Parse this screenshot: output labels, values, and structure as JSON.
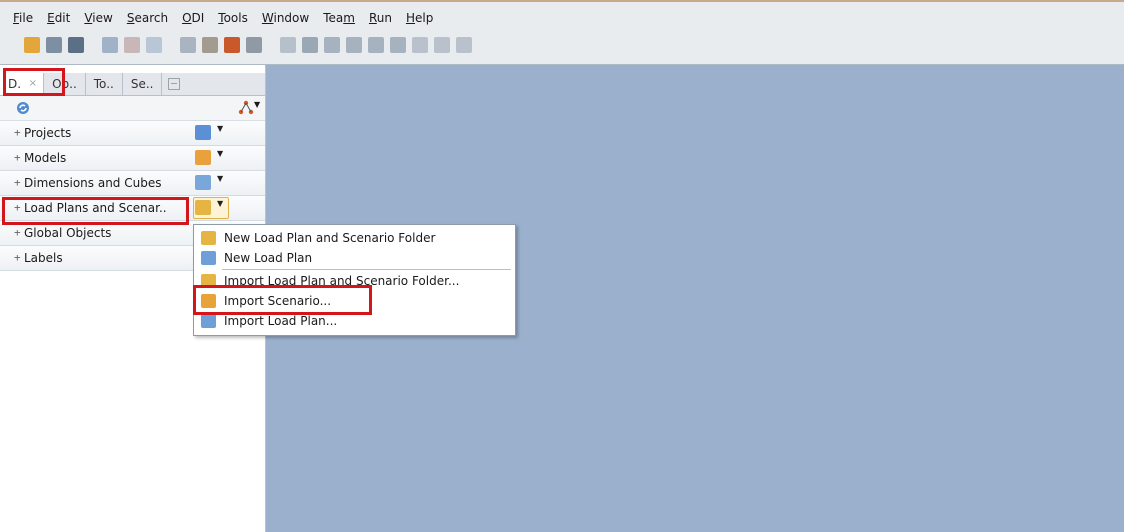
{
  "menubar": {
    "items": [
      {
        "pre": "",
        "mn": "F",
        "post": "ile"
      },
      {
        "pre": "",
        "mn": "E",
        "post": "dit"
      },
      {
        "pre": "",
        "mn": "V",
        "post": "iew"
      },
      {
        "pre": "",
        "mn": "S",
        "post": "earch"
      },
      {
        "pre": "",
        "mn": "O",
        "post": "DI"
      },
      {
        "pre": "",
        "mn": "T",
        "post": "ools"
      },
      {
        "pre": "",
        "mn": "W",
        "post": "indow"
      },
      {
        "pre": "Tea",
        "mn": "m",
        "post": ""
      },
      {
        "pre": "",
        "mn": "R",
        "post": "un"
      },
      {
        "pre": "",
        "mn": "H",
        "post": "elp"
      }
    ]
  },
  "toolbar": {
    "icons": [
      "new-icon",
      "save-icon",
      "save-all-icon",
      "gap",
      "run-icon",
      "debug-icon",
      "play-icon",
      "gap",
      "breakpoint-icon",
      "bug-icon",
      "step-icon",
      "step-over-icon",
      "gap",
      "agent-icon",
      "session-icon",
      "db-icon-1",
      "db-icon-2",
      "db-icon-3",
      "db-icon-4",
      "pause-icon",
      "resume-icon",
      "forward-icon"
    ]
  },
  "tabs": [
    {
      "label": "D.",
      "active": true
    },
    {
      "label": "Op..",
      "active": false
    },
    {
      "label": "To..",
      "active": false
    },
    {
      "label": "Se..",
      "active": false
    }
  ],
  "accordion": [
    {
      "label": "Projects",
      "name": "projects",
      "color": "#5b8fd6"
    },
    {
      "label": "Models",
      "name": "models",
      "color": "#e9a23b"
    },
    {
      "label": "Dimensions and Cubes",
      "name": "dimensions-and-cubes",
      "color": "#7aa7d9"
    },
    {
      "label": "Load Plans and Scenar..",
      "name": "load-plans-and-scenarios",
      "color": "#e5b443",
      "highlight": true
    },
    {
      "label": "Global Objects",
      "name": "global-objects"
    },
    {
      "label": "Labels",
      "name": "labels"
    }
  ],
  "context_menu": {
    "items": [
      {
        "label": "New Load Plan and Scenario Folder",
        "name": "new-load-plan-and-scenario-folder",
        "icon_color": "#e5b443"
      },
      {
        "label": "New Load Plan",
        "name": "new-load-plan",
        "icon_color": "#6f9fd8"
      },
      {
        "separator": true
      },
      {
        "label": "Import Load Plan and Scenario Folder...",
        "name": "import-load-plan-and-scenario-folder",
        "icon_color": "#e5b443"
      },
      {
        "label": "Import Scenario...",
        "name": "import-scenario",
        "icon_color": "#e7a23a"
      },
      {
        "label": "Import Load Plan...",
        "name": "import-load-plan",
        "icon_color": "#6f9fd8"
      }
    ]
  },
  "colors": {
    "background": "#9ab0cd",
    "callout": "#d3161c"
  }
}
